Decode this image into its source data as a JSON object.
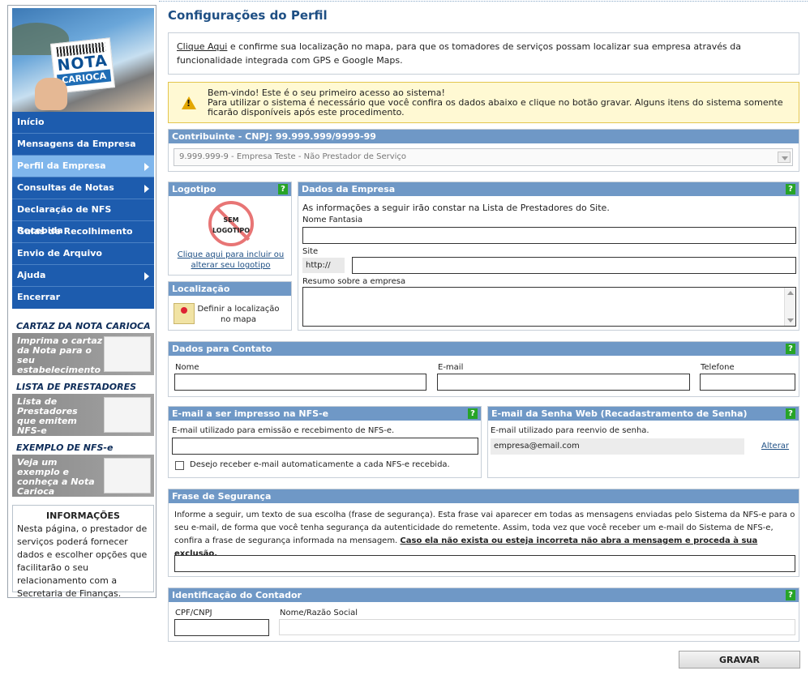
{
  "sidebar": {
    "logo": {
      "line1": "NOTA",
      "line2": "CARIOCA"
    },
    "menu": [
      {
        "label": "Início",
        "has_submenu": false,
        "active": false
      },
      {
        "label": "Mensagens da Empresa",
        "has_submenu": false,
        "active": false
      },
      {
        "label": "Perfil da Empresa",
        "has_submenu": true,
        "active": true
      },
      {
        "label": "Consultas de Notas",
        "has_submenu": true,
        "active": false
      },
      {
        "label": "Declaração de NFS Recebida",
        "has_submenu": false,
        "active": false
      },
      {
        "label": "Guias de Recolhimento",
        "has_submenu": false,
        "active": false
      },
      {
        "label": "Envio de Arquivo",
        "has_submenu": false,
        "active": false
      },
      {
        "label": "Ajuda",
        "has_submenu": true,
        "active": false
      },
      {
        "label": "Encerrar",
        "has_submenu": false,
        "active": false
      }
    ],
    "promos": [
      {
        "title": "CARTAZ DA NOTA CARIOCA",
        "text": "Imprima o cartaz da Nota para o seu estabelecimento"
      },
      {
        "title": "LISTA DE PRESTADORES",
        "text": "Lista de Prestadores que emitem NFS-e"
      },
      {
        "title": "EXEMPLO DE NFS-e",
        "text": "Veja um exemplo e conheça a Nota Carioca"
      }
    ],
    "info": {
      "title": "INFORMAÇÕES",
      "body": "Nesta página, o prestador de serviços poderá fornecer dados e escolher opções que facilitarão o seu relacionamento com a Secretaria de Finanças."
    }
  },
  "page": {
    "title": "Configurações do Perfil",
    "notice_link": "Clique Aqui",
    "notice_text": " e confirme sua localização no mapa, para que os tomadores de serviços possam localizar sua empresa através da funcionalidade integrada com GPS e Google Maps.",
    "warning_line1": "Bem-vindo! Este é o seu primeiro acesso ao sistema!",
    "warning_line2": "Para utilizar o sistema é necessário que você confira os dados abaixo e clique no botão gravar. Alguns itens do sistema somente ficarão disponíveis após este procedimento."
  },
  "contribuinte": {
    "header": "Contribuinte - CNPJ: 99.999.999/9999-99",
    "selected": "9.999.999-9 - Empresa Teste - Não Prestador de Serviço"
  },
  "logotipo": {
    "header": "Logotipo",
    "placeholder_line1": "SEM",
    "placeholder_line2": "LOGOTIPO",
    "link": "Clique aqui para incluir ou alterar seu logotipo"
  },
  "localizacao": {
    "header": "Localização",
    "link": "Definir a localização no mapa"
  },
  "dados_empresa": {
    "header": "Dados da Empresa",
    "intro": "As informações a seguir irão constar na Lista de Prestadores do Site.",
    "nome_fantasia_label": "Nome Fantasia",
    "nome_fantasia_value": "",
    "site_label": "Site",
    "site_prefix": "http://",
    "site_value": "",
    "resumo_label": "Resumo sobre a empresa",
    "resumo_value": ""
  },
  "contato": {
    "header": "Dados para Contato",
    "nome_label": "Nome",
    "email_label": "E-mail",
    "telefone_label": "Telefone"
  },
  "email_nfse": {
    "header": "E-mail a ser impresso na NFS-e",
    "desc": "E-mail utilizado para emissão e recebimento de NFS-e.",
    "value": "",
    "checkbox_label": "Desejo receber e-mail automaticamente a cada NFS-e recebida.",
    "checked": false
  },
  "email_senha": {
    "header": "E-mail da Senha Web (Recadastramento de Senha)",
    "desc": "E-mail utilizado para reenvio de senha.",
    "value": "empresa@email.com",
    "alterar": "Alterar"
  },
  "frase": {
    "header": "Frase de Segurança",
    "text": "Informe a seguir, um texto de sua escolha (frase de segurança). Esta frase vai aparecer em todas as mensagens enviadas pelo Sistema da NFS-e para o seu e-mail, de forma que você tenha segurança da autenticidade do remetente. Assim, toda vez que você receber um e-mail do Sistema de NFS-e, confira a frase de segurança informada na mensagem. ",
    "bold": "Caso ela não exista ou esteja incorreta não abra a mensagem e proceda à sua exclusão."
  },
  "contador": {
    "header": "Identificação do Contador",
    "cpf_label": "CPF/CNPJ",
    "nome_label": "Nome/Razão Social"
  },
  "buttons": {
    "gravar": "GRAVAR"
  },
  "help_label": "?"
}
